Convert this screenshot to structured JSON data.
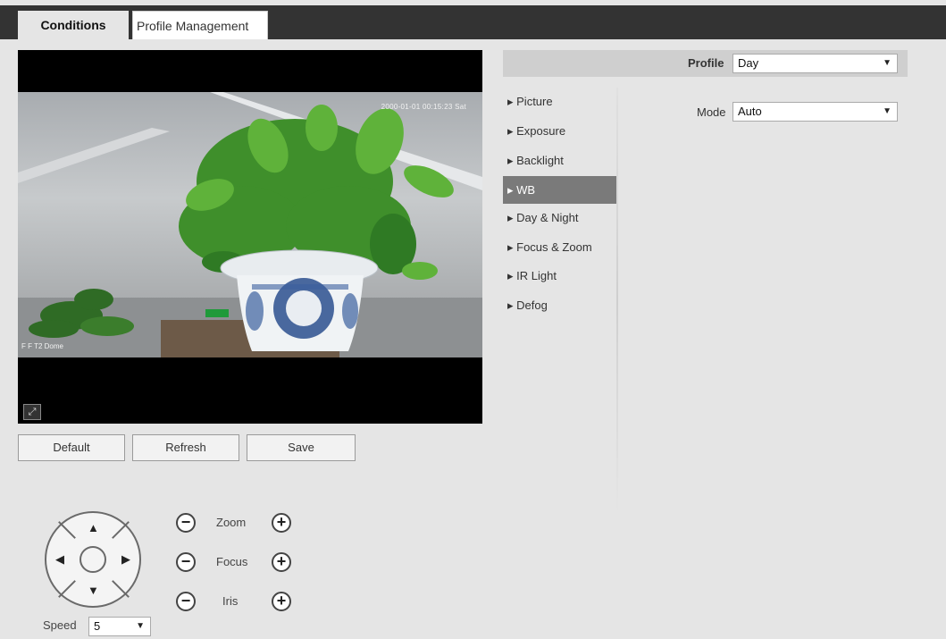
{
  "tabs": [
    {
      "label": "Conditions",
      "active": true
    },
    {
      "label": "Profile Management",
      "active": false
    }
  ],
  "video": {
    "timestamp": "2000-01-01 00:15:23 Sat",
    "camera_name": "F F T2 Dome",
    "fullscreen_icon": "fullscreen-icon"
  },
  "actions": {
    "default_label": "Default",
    "refresh_label": "Refresh",
    "save_label": "Save"
  },
  "ptz": {
    "zoom_label": "Zoom",
    "focus_label": "Focus",
    "iris_label": "Iris",
    "minus_icon": "minus-icon",
    "plus_icon": "plus-icon",
    "speed_label": "Speed",
    "speed_value": "5"
  },
  "profile": {
    "label": "Profile",
    "value": "Day"
  },
  "menu": {
    "items": [
      {
        "label": "Picture"
      },
      {
        "label": "Exposure"
      },
      {
        "label": "Backlight"
      },
      {
        "label": "WB",
        "active": true
      },
      {
        "label": "Day & Night"
      },
      {
        "label": "Focus & Zoom"
      },
      {
        "label": "IR Light"
      },
      {
        "label": "Defog"
      }
    ]
  },
  "wb": {
    "mode_label": "Mode",
    "mode_value": "Auto"
  },
  "colors": {
    "topbar": "#333333",
    "active_menu": "#7a7a7a",
    "background": "#e5e5e5"
  }
}
